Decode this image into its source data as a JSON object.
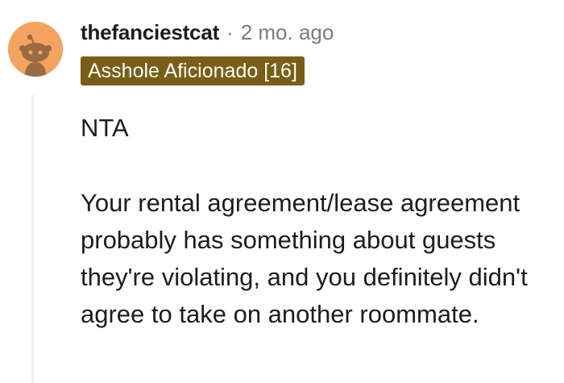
{
  "comment": {
    "username": "thefanciestcat",
    "separator": "·",
    "timestamp": "2 mo. ago",
    "flair": "Asshole Aficionado [16]",
    "paragraphs": [
      "NTA",
      "Your rental agreement/lease agreement probably has something about guests they're violating, and you definitely didn't agree to take on another roommate."
    ]
  },
  "colors": {
    "avatar_bg": "#f3a35f",
    "flair_bg": "#7a5d16",
    "flair_text": "#ffffff",
    "meta_gray": "#7c7c7c",
    "thread_line": "#edeff1"
  },
  "icons": {
    "avatar": "snoo-avatar-icon"
  }
}
